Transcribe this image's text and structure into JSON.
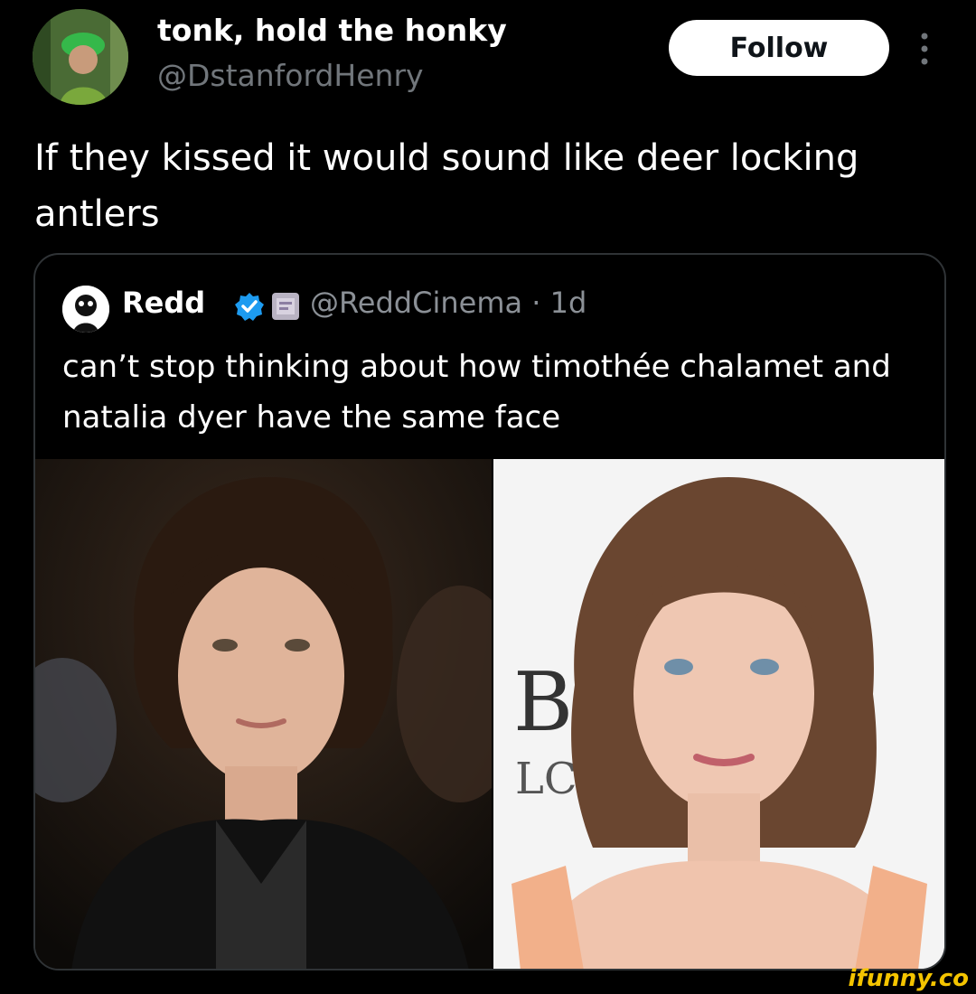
{
  "post": {
    "display_name": "tonk, hold the honky",
    "handle": "@DstanfordHenry",
    "follow_label": "Follow",
    "text": "If they kissed it would sound like deer locking antlers"
  },
  "quoted": {
    "name": "Redd",
    "handle_time": "@ReddCinema · 1d",
    "text": "can’t stop thinking about how timothée chalamet and natalia dyer have the same face",
    "sign_letters": "B\nLC"
  },
  "watermark": "ifunny.co",
  "colors": {
    "background": "#000000",
    "verified": "#1d9bf0",
    "watermark": "#f4c400"
  },
  "icons": [
    "avatar",
    "more-icon",
    "verified-badge-icon",
    "affiliate-badge-icon"
  ]
}
